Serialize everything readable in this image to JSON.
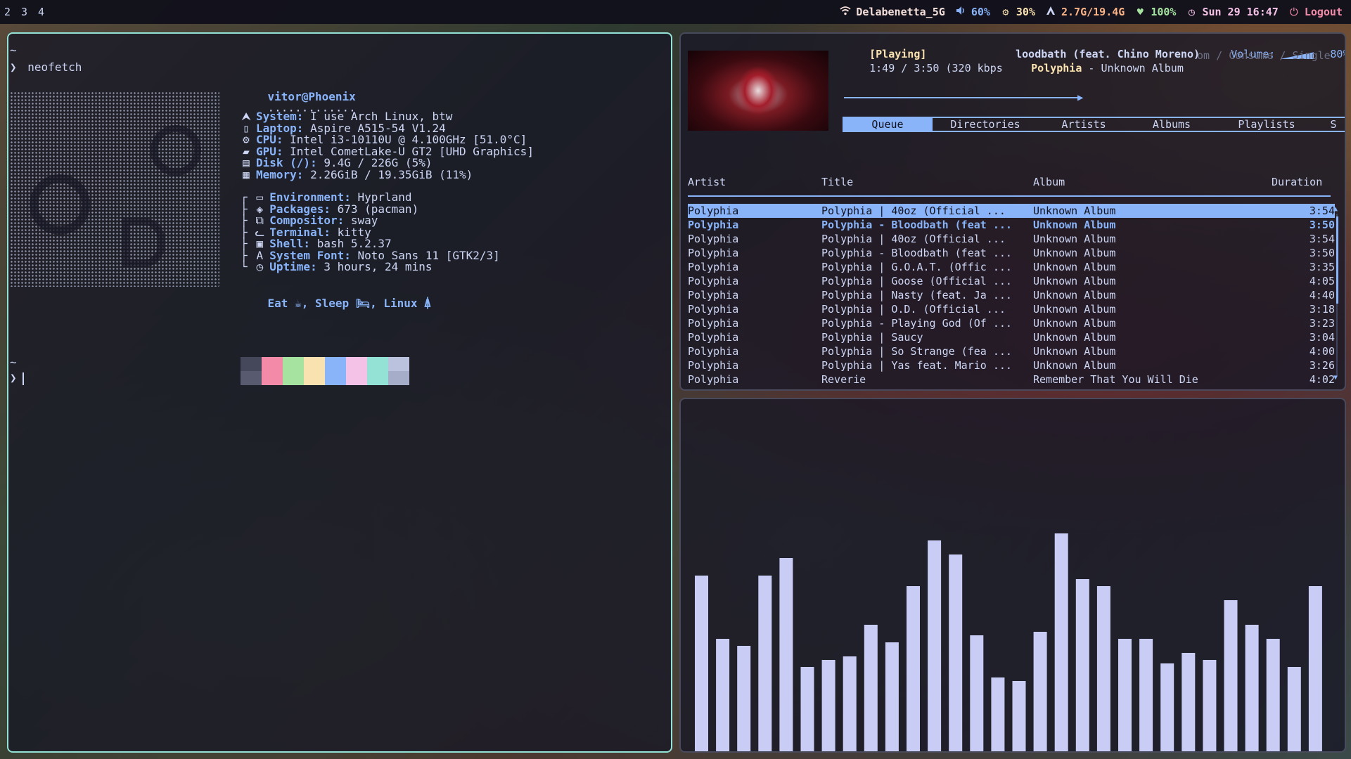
{
  "topbar": {
    "workspaces": [
      "2",
      "3",
      "4"
    ],
    "wifi": "Delabenetta_5G",
    "volume": "60%",
    "cpu": "30%",
    "memory": "2.7G/19.4G",
    "battery": "100%",
    "clock": "Sun 29 16:47",
    "logout": "Logout",
    "icons": [
      "wifi-icon",
      "volume-icon",
      "cpu-icon",
      "memory-icon",
      "heart-icon",
      "clock-icon",
      "power-icon"
    ]
  },
  "terminal": {
    "prompt_dir": "~",
    "prompt_arrow": "❯",
    "command": "neofetch",
    "title_line": "vitor@Phoenix",
    "dots": "·············",
    "system_info": [
      {
        "icon": "arch-icon",
        "glyph": "⮝",
        "key": "System:",
        "value": " I use Arch Linux, btw"
      },
      {
        "icon": "laptop-icon",
        "glyph": "▯",
        "key": "Laptop:",
        "value": " Aspire A515-54 V1.24"
      },
      {
        "icon": "cpu-icon",
        "glyph": "⚙",
        "key": "CPU:",
        "value": " Intel i3-10110U @ 4.100GHz [51.0°C]"
      },
      {
        "icon": "gpu-icon",
        "glyph": "▰",
        "key": "GPU:",
        "value": " Intel CometLake-U GT2 [UHD Graphics]"
      },
      {
        "icon": "disk-icon",
        "glyph": "▤",
        "key": "Disk (/):",
        "value": " 9.4G / 226G (5%)"
      },
      {
        "icon": "memory-icon",
        "glyph": "▦",
        "key": "Memory:",
        "value": " 2.26GiB / 19.35GiB (11%)"
      }
    ],
    "env_info": [
      {
        "tree": "┌",
        "icon": "monitor-icon",
        "glyph": "▭",
        "key": "Environment:",
        "value": " Hyprland"
      },
      {
        "tree": "├",
        "icon": "package-icon",
        "glyph": "◈",
        "key": "Packages:",
        "value": " 673 (pacman)"
      },
      {
        "tree": "├",
        "icon": "window-icon",
        "glyph": "⧉",
        "key": "Compositor:",
        "value": " sway"
      },
      {
        "tree": "├",
        "icon": "cat-icon",
        "glyph": "ᓚ",
        "key": "Terminal:",
        "value": " kitty"
      },
      {
        "tree": "├",
        "icon": "shell-icon",
        "glyph": "▣",
        "key": "Shell:",
        "value": " bash 5.2.37"
      },
      {
        "tree": "├",
        "icon": "font-icon",
        "glyph": "A",
        "key": "System Font:",
        "value": " Noto Sans 11 [GTK2/3]"
      },
      {
        "tree": "└",
        "icon": "clock-icon",
        "glyph": "◷",
        "key": "Uptime:",
        "value": " 3 hours, 24 mins"
      }
    ],
    "motto": "Eat ☕, Sleep 🛏, Linux ⍋",
    "swatches_top": [
      "#45475a",
      "#f38ba8",
      "#a6e3a1",
      "#f9e2af",
      "#89b4fa",
      "#f5c2e7",
      "#94e2d5",
      "#bac2de"
    ],
    "swatches_bottom": [
      "#585b70",
      "#f38ba8",
      "#a6e3a1",
      "#f9e2af",
      "#89b4fa",
      "#f5c2e7",
      "#94e2d5",
      "#a6adc8"
    ],
    "prompt2_dir": "~",
    "prompt2_arrow": "❯"
  },
  "player": {
    "state": "[Playing]",
    "now_title": "loodbath (feat. Chino Moreno)",
    "volume_label": "Volume:",
    "volume_value": "80%",
    "volume_level": 0.8,
    "time": "1:49 / 3:50 (320 kbps",
    "now_artist": "Polyphia",
    "now_sep": " - ",
    "now_album": "Unknown Album",
    "modes": "om / Consume / Single",
    "progress": 0.47,
    "tabs": [
      "Queue",
      "Directories",
      "Artists",
      "Albums",
      "Playlists",
      "S"
    ],
    "columns": {
      "artist": "Artist",
      "title": "Title",
      "album": "Album",
      "duration": "Duration"
    },
    "songs": [
      {
        "artist": "Polyphia",
        "title": "Polyphia | 40oz (Official ...",
        "album": "Unknown Album",
        "duration": "3:54"
      },
      {
        "artist": "Polyphia",
        "title": "Polyphia - Bloodbath (feat ...",
        "album": "Unknown Album",
        "duration": "3:50"
      },
      {
        "artist": "Polyphia",
        "title": "Polyphia | 40oz (Official ...",
        "album": "Unknown Album",
        "duration": "3:54"
      },
      {
        "artist": "Polyphia",
        "title": "Polyphia - Bloodbath (feat ...",
        "album": "Unknown Album",
        "duration": "3:50"
      },
      {
        "artist": "Polyphia",
        "title": "Polyphia | G.O.A.T. (Offic ...",
        "album": "Unknown Album",
        "duration": "3:35"
      },
      {
        "artist": "Polyphia",
        "title": "Polyphia | Goose (Official ...",
        "album": "Unknown Album",
        "duration": "4:05"
      },
      {
        "artist": "Polyphia",
        "title": "Polyphia | Nasty (feat. Ja ...",
        "album": "Unknown Album",
        "duration": "4:40"
      },
      {
        "artist": "Polyphia",
        "title": "Polyphia | O.D. (Official ...",
        "album": "Unknown Album",
        "duration": "3:18"
      },
      {
        "artist": "Polyphia",
        "title": "Polyphia - Playing God (Of ...",
        "album": "Unknown Album",
        "duration": "3:23"
      },
      {
        "artist": "Polyphia",
        "title": "Polyphia | Saucy",
        "album": "Unknown Album",
        "duration": "3:04"
      },
      {
        "artist": "Polyphia",
        "title": "Polyphia | So Strange (fea ...",
        "album": "Unknown Album",
        "duration": "4:00"
      },
      {
        "artist": "Polyphia",
        "title": "Polyphia | Yas feat. Mario ...",
        "album": "Unknown Album",
        "duration": "3:26"
      },
      {
        "artist": "Polyphia",
        "title": "Reverie",
        "album": "Remember That You Will Die",
        "duration": "4:02"
      }
    ],
    "selected_index": 0,
    "current_index": 1
  },
  "cava": {
    "bar_color": "#c9cdf5",
    "levels": [
      0.5,
      0.32,
      0.3,
      0.5,
      0.55,
      0.24,
      0.26,
      0.27,
      0.36,
      0.31,
      0.47,
      0.6,
      0.56,
      0.33,
      0.21,
      0.2,
      0.34,
      0.62,
      0.49,
      0.47,
      0.32,
      0.32,
      0.25,
      0.28,
      0.26,
      0.43,
      0.36,
      0.32,
      0.24,
      0.47
    ]
  }
}
